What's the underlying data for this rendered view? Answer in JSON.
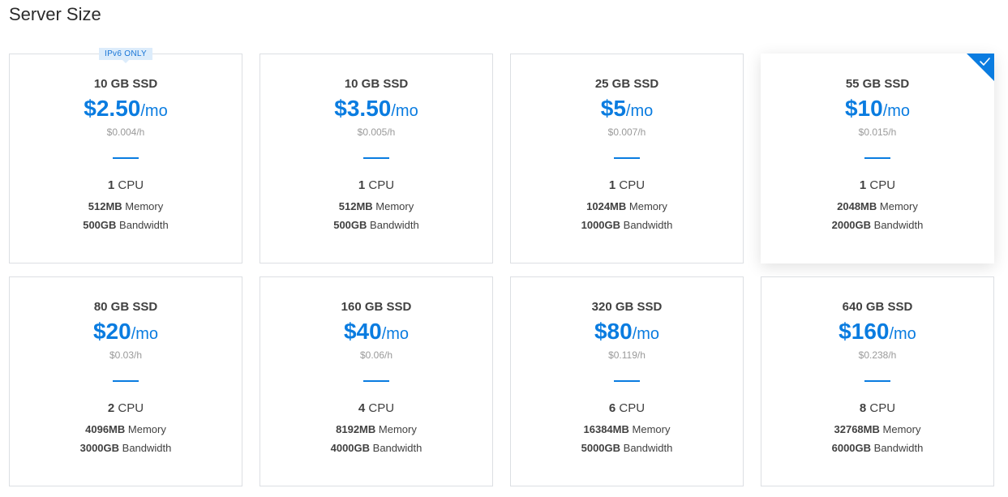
{
  "title": "Server Size",
  "colors": {
    "accent": "#0a7ce0",
    "badge_bg": "#dcecfb",
    "border": "#dcdfe3"
  },
  "plans": [
    {
      "ssd": "10 GB SSD",
      "price": "$2.50",
      "per": "/mo",
      "hourly": "$0.004/h",
      "cpu_count": "1",
      "cpu_label": "CPU",
      "memory": "512MB",
      "memory_label": "Memory",
      "bandwidth": "500GB",
      "bandwidth_label": "Bandwidth",
      "badge": "IPv6 ONLY",
      "selected": false
    },
    {
      "ssd": "10 GB SSD",
      "price": "$3.50",
      "per": "/mo",
      "hourly": "$0.005/h",
      "cpu_count": "1",
      "cpu_label": "CPU",
      "memory": "512MB",
      "memory_label": "Memory",
      "bandwidth": "500GB",
      "bandwidth_label": "Bandwidth",
      "badge": "",
      "selected": false
    },
    {
      "ssd": "25 GB SSD",
      "price": "$5",
      "per": "/mo",
      "hourly": "$0.007/h",
      "cpu_count": "1",
      "cpu_label": "CPU",
      "memory": "1024MB",
      "memory_label": "Memory",
      "bandwidth": "1000GB",
      "bandwidth_label": "Bandwidth",
      "badge": "",
      "selected": false
    },
    {
      "ssd": "55 GB SSD",
      "price": "$10",
      "per": "/mo",
      "hourly": "$0.015/h",
      "cpu_count": "1",
      "cpu_label": "CPU",
      "memory": "2048MB",
      "memory_label": "Memory",
      "bandwidth": "2000GB",
      "bandwidth_label": "Bandwidth",
      "badge": "",
      "selected": true
    },
    {
      "ssd": "80 GB SSD",
      "price": "$20",
      "per": "/mo",
      "hourly": "$0.03/h",
      "cpu_count": "2",
      "cpu_label": "CPU",
      "memory": "4096MB",
      "memory_label": "Memory",
      "bandwidth": "3000GB",
      "bandwidth_label": "Bandwidth",
      "badge": "",
      "selected": false
    },
    {
      "ssd": "160 GB SSD",
      "price": "$40",
      "per": "/mo",
      "hourly": "$0.06/h",
      "cpu_count": "4",
      "cpu_label": "CPU",
      "memory": "8192MB",
      "memory_label": "Memory",
      "bandwidth": "4000GB",
      "bandwidth_label": "Bandwidth",
      "badge": "",
      "selected": false
    },
    {
      "ssd": "320 GB SSD",
      "price": "$80",
      "per": "/mo",
      "hourly": "$0.119/h",
      "cpu_count": "6",
      "cpu_label": "CPU",
      "memory": "16384MB",
      "memory_label": "Memory",
      "bandwidth": "5000GB",
      "bandwidth_label": "Bandwidth",
      "badge": "",
      "selected": false
    },
    {
      "ssd": "640 GB SSD",
      "price": "$160",
      "per": "/mo",
      "hourly": "$0.238/h",
      "cpu_count": "8",
      "cpu_label": "CPU",
      "memory": "32768MB",
      "memory_label": "Memory",
      "bandwidth": "6000GB",
      "bandwidth_label": "Bandwidth",
      "badge": "",
      "selected": false
    }
  ]
}
